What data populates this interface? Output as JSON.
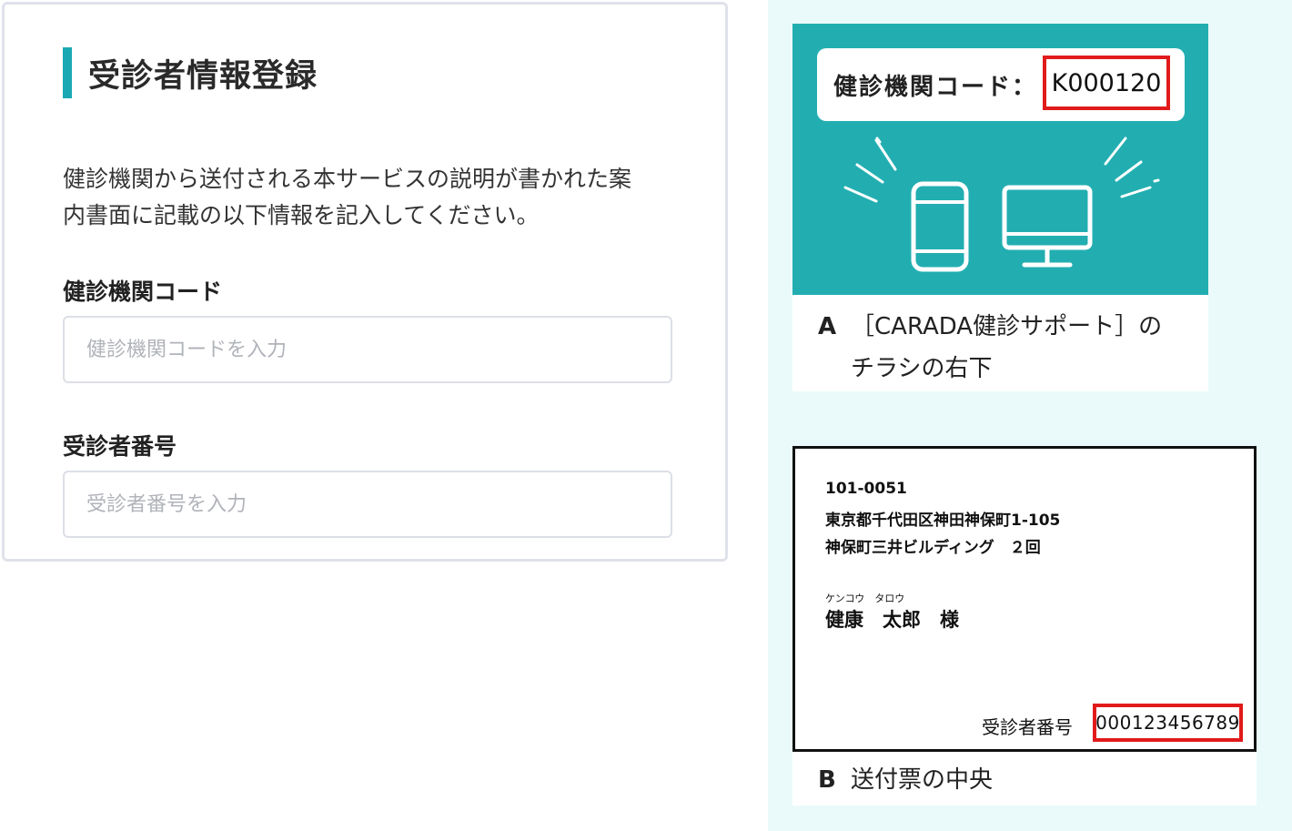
{
  "form": {
    "title": "受診者情報登録",
    "intro_line1": "健診機関から送付される本サービスの説明が書かれた案",
    "intro_line2": "内書面に記載の以下情報を記入してください。",
    "clinic_code": {
      "label": "健診機関コード",
      "placeholder": "健診機関コードを入力",
      "value": ""
    },
    "patient_number": {
      "label": "受診者番号",
      "placeholder": "受診者番号を入力",
      "value": ""
    }
  },
  "guide": {
    "flyer": {
      "code_label": "健診機関コード：",
      "code_value": "K000120",
      "caption_letter": "A",
      "caption_line1": "［CARADA健診サポート］の",
      "caption_line2": "チラシの右下",
      "icons": [
        "smartphone-icon",
        "monitor-icon"
      ]
    },
    "envelope": {
      "postal_code": "101-0051",
      "address_line1": "東京都千代田区神田神保町1-105",
      "address_line2": "神保町三井ビルディング　２回",
      "furigana": "ケンコウ　タロウ",
      "recipient": "健康　太郎　様",
      "patient_label": "受診者番号",
      "patient_value": "000123456789",
      "caption_letter": "B",
      "caption_text": "送付票の中央"
    }
  },
  "colors": {
    "accent": "#1aa9b2",
    "flyer_teal": "#22aeb1",
    "highlight_red": "#e11b1b",
    "side_panel_bg": "#eafafb"
  }
}
